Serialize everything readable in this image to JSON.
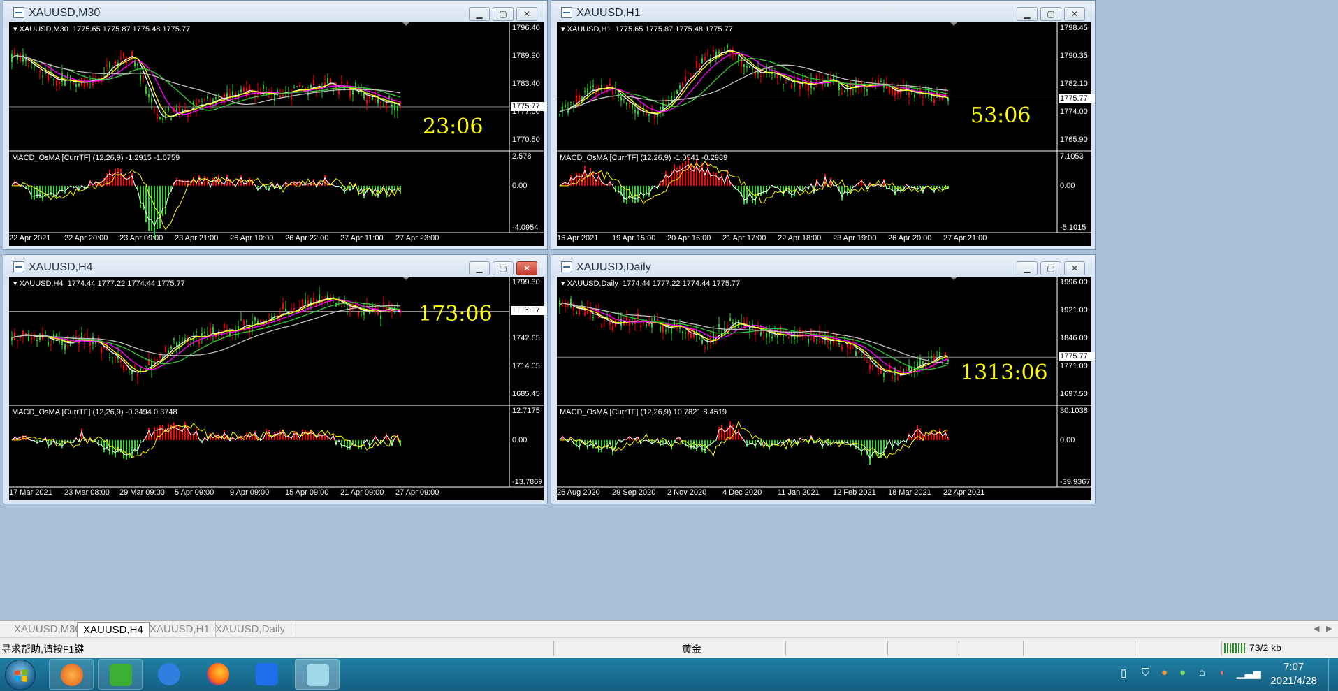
{
  "windows": [
    {
      "title": "XAUUSD,M30",
      "ohlc": "XAUUSD,M30  1775.65 1775.87 1775.48 1775.77",
      "price_ticks": [
        "1796.40",
        "1789.90",
        "1783.40",
        "1777.00",
        "1770.50"
      ],
      "current_price": "1775.77",
      "macd_label": "MACD_OsMA [CurrTF] (12,26,9) -1.2915 -1.0759",
      "macd_ticks": [
        "2.578",
        "0.00",
        "-4.0954"
      ],
      "x_labels": [
        "22 Apr 2021",
        "22 Apr 20:00",
        "23 Apr 09:00",
        "23 Apr 21:00",
        "26 Apr 10:00",
        "26 Apr 22:00",
        "27 Apr 11:00",
        "27 Apr 23:00"
      ],
      "countdown": "23:06"
    },
    {
      "title": "XAUUSD,H1",
      "ohlc": "XAUUSD,H1  1775.65 1775.87 1775.48 1775.77",
      "price_ticks": [
        "1798.45",
        "1790.35",
        "1782.10",
        "1774.00",
        "1765.90"
      ],
      "current_price": "1775.77",
      "macd_label": "MACD_OsMA [CurrTF] (12,26,9) -1.0541 -0.2989",
      "macd_ticks": [
        "7.1053",
        "0.00",
        "-5.1015"
      ],
      "x_labels": [
        "16 Apr 2021",
        "19 Apr 15:00",
        "20 Apr 16:00",
        "21 Apr 17:00",
        "22 Apr 18:00",
        "23 Apr 19:00",
        "26 Apr 20:00",
        "27 Apr 21:00"
      ],
      "countdown": "53:06"
    },
    {
      "title": "XAUUSD,H4",
      "ohlc": "XAUUSD,H4  1774.44 1777.22 1774.44 1775.77",
      "price_ticks": [
        "1799.30",
        "1770.70",
        "1742.65",
        "1714.05",
        "1685.45"
      ],
      "current_price": "1775.77",
      "macd_label": "MACD_OsMA [CurrTF] (12,26,9) -0.3494 0.3748",
      "macd_ticks": [
        "12.7175",
        "0.00",
        "-13.7869"
      ],
      "x_labels": [
        "17 Mar 2021",
        "23 Mar 08:00",
        "29 Mar 09:00",
        "5 Apr 09:00",
        "9 Apr 09:00",
        "15 Apr 09:00",
        "21 Apr 09:00",
        "27 Apr 09:00"
      ],
      "countdown": "173:06"
    },
    {
      "title": "XAUUSD,Daily",
      "ohlc": "XAUUSD,Daily  1774.44 1777.22 1774.44 1775.77",
      "price_ticks": [
        "1996.00",
        "1921.00",
        "1846.00",
        "1771.00",
        "1697.50"
      ],
      "current_price": "1775.77",
      "macd_label": "MACD_OsMA [CurrTF] (12,26,9) 10.7821 8.4519",
      "macd_ticks": [
        "30.1038",
        "0.00",
        "-39.9367"
      ],
      "x_labels": [
        "26 Aug 2020",
        "29 Sep 2020",
        "2 Nov 2020",
        "4 Dec 2020",
        "11 Jan 2021",
        "12 Feb 2021",
        "18 Mar 2021",
        "22 Apr 2021"
      ],
      "countdown": "1313:06"
    }
  ],
  "tabs": [
    "XAUUSD,M30",
    "XAUUSD,H4",
    "XAUUSD,H1",
    "XAUUSD,Daily"
  ],
  "active_tab": "XAUUSD,H4",
  "status": {
    "help": "寻求帮助,请按F1键",
    "profile": "黄金",
    "traffic": "73/2 kb"
  },
  "taskbar": {
    "time": "7:07",
    "date": "2021/4/28",
    "apps": [
      "start-menu",
      "app-launcher",
      "wechat",
      "writing-app",
      "firefox",
      "tencent-meeting",
      "metatrader"
    ]
  },
  "colors": {
    "chart_bg": "#000000",
    "bull_candle": "#32cd32",
    "bear_candle": "#ff0000",
    "ma_white": "#ffffff",
    "ma_yellow": "#ffff00",
    "ma_magenta": "#ff00ff",
    "ma_green": "#32cd32",
    "ma_gray": "#c0c0c0",
    "countdown": "#ffff00"
  }
}
